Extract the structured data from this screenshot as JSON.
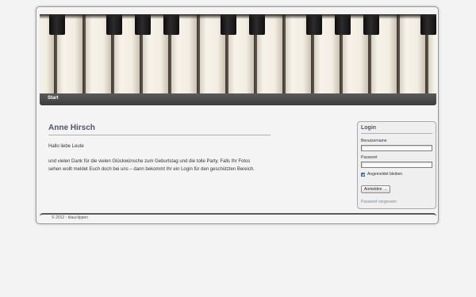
{
  "nav": {
    "items": [
      {
        "label": "Start"
      }
    ]
  },
  "main": {
    "title": "Anne Hirsch",
    "greeting": "Hallo liebe Leute",
    "body": "und vielen Dank für die vielen Glückwünsche zum Geburtstag und die tolle Party. Falls Ihr Fotos sehen wollt meldet Euch doch bei uns – dann bekommt Ihr ein Login für den geschützten Bereich."
  },
  "login": {
    "title": "Login",
    "username_label": "Benutzername",
    "username_value": "",
    "password_label": "Passwort",
    "password_value": "",
    "remember_label": "Angemeldet bleiben",
    "remember_checked": true,
    "submit_label": "Anmelden →",
    "forgot_label": "Passwort vergessen"
  },
  "footer": {
    "text": "© 2012 - blauclippen"
  },
  "colors": {
    "accent": "#4a5566",
    "nav_bg": "#4a4a4a",
    "page_bg": "#f3f3f3"
  }
}
